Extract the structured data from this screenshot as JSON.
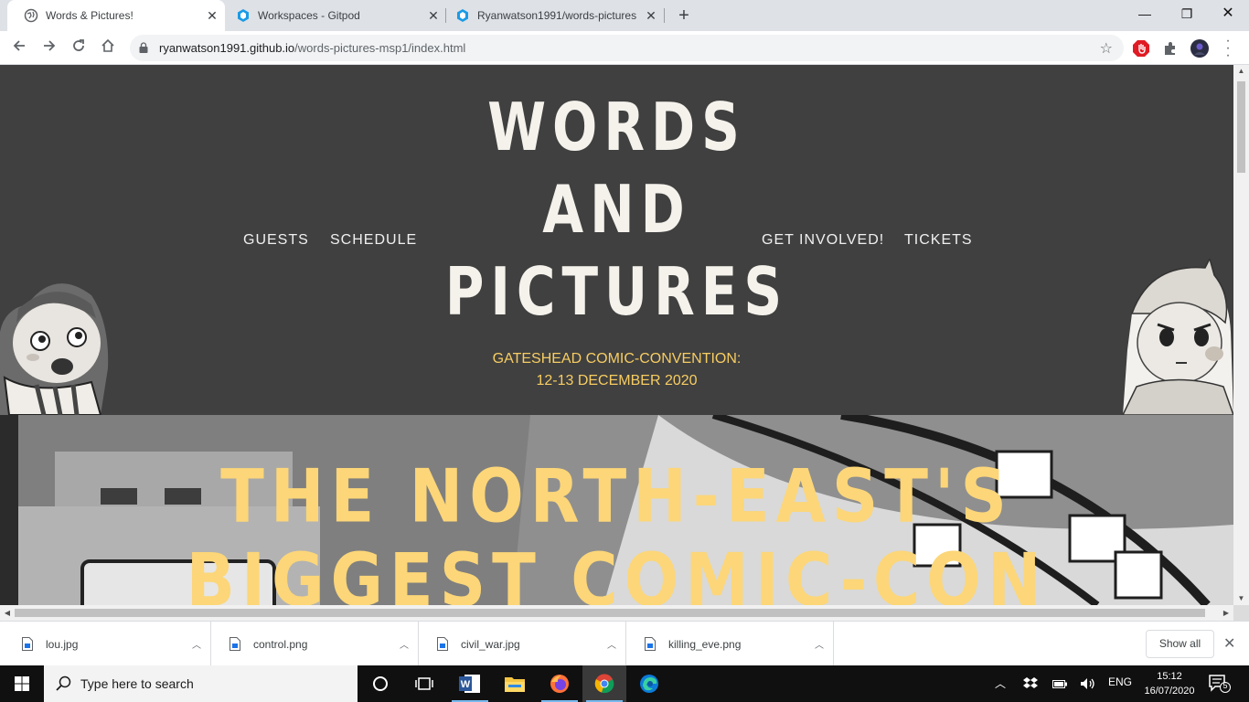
{
  "browser": {
    "tabs": [
      {
        "title": "Words & Pictures!",
        "active": true
      },
      {
        "title": "Workspaces - Gitpod",
        "active": false
      },
      {
        "title": "Ryanwatson1991/words-pictures",
        "active": false
      }
    ],
    "address": {
      "host": "ryanwatson1991.github.io",
      "path": "/words-pictures-msp1/index.html"
    }
  },
  "site": {
    "logo_lines": [
      "WORDS",
      "AND",
      "PICTURES"
    ],
    "nav_left": [
      "GUESTS",
      "SCHEDULE"
    ],
    "nav_right": [
      "GET INVOLVED!",
      "TICKETS"
    ],
    "tagline": [
      "GATESHEAD COMIC-CONVENTION:",
      "12-13 DECEMBER 2020"
    ],
    "hero_title": [
      "THE NORTH-EAST'S",
      "BIGGEST COMIC-CON"
    ],
    "colors": {
      "header_bg": "#404040",
      "accent": "#f7cd62",
      "logo": "#f5f2ec"
    }
  },
  "downloads": {
    "items": [
      "lou.jpg",
      "control.png",
      "civil_war.jpg",
      "killing_eve.png"
    ],
    "show_all": "Show all"
  },
  "taskbar": {
    "search_placeholder": "Type here to search",
    "language": "ENG",
    "time": "15:12",
    "date": "16/07/2020",
    "notifications": "5"
  }
}
